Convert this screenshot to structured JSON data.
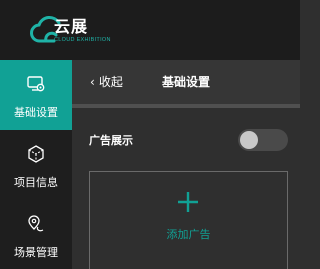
{
  "brand": {
    "name": "云展",
    "tagline": "CLOUD EXHIBITION",
    "accent_color": "#11a195"
  },
  "sidebar": {
    "items": [
      {
        "label": "基础设置",
        "icon": "settings-screen-icon",
        "active": true
      },
      {
        "label": "项目信息",
        "icon": "cube-icon",
        "active": false
      },
      {
        "label": "场景管理",
        "icon": "location-pin-icon",
        "active": false
      }
    ]
  },
  "subheader": {
    "back_label": "收起",
    "title": "基础设置"
  },
  "content": {
    "ad_display_label": "广告展示",
    "ad_display_enabled": false,
    "add_ad_label": "添加广告"
  }
}
